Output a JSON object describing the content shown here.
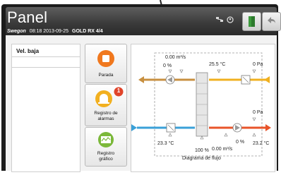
{
  "header": {
    "title": "Panel",
    "brand": "Swegon",
    "datetime": "08:18 2013-09-25",
    "model": "GOLD RX  4/4"
  },
  "sidebar": {
    "items": [
      {
        "label": "Vel. baja"
      }
    ]
  },
  "tiles": [
    {
      "label": "Parada",
      "icon": "stop-icon"
    },
    {
      "label": "Registro de alarmas",
      "line1": "Registro de",
      "line2": "alarmas",
      "badge": "1",
      "icon": "bell-icon"
    },
    {
      "label": "Registro gráfico",
      "line1": "Registro",
      "line2": "gráfico",
      "icon": "graph-icon"
    }
  ],
  "diagram": {
    "caption": "Diagrama de flujo",
    "top_flow": "0.00 m³/s",
    "top_pct": "0 %",
    "top_temp": "25.5 °C",
    "top_pa": "0 Pa",
    "right_pa": "0 Pa",
    "bottom_temp_left": "23.3 °C",
    "bottom_pct_center": "100 %",
    "bottom_flow": "0.00 m³/s",
    "bottom_pct_right": "0 %",
    "bottom_temp_right": "23.2 °C"
  },
  "colors": {
    "supply_cold": "#3aa0d8",
    "supply_hot": "#e8542a",
    "extract": "#f0b020",
    "exhaust": "#c89040"
  }
}
